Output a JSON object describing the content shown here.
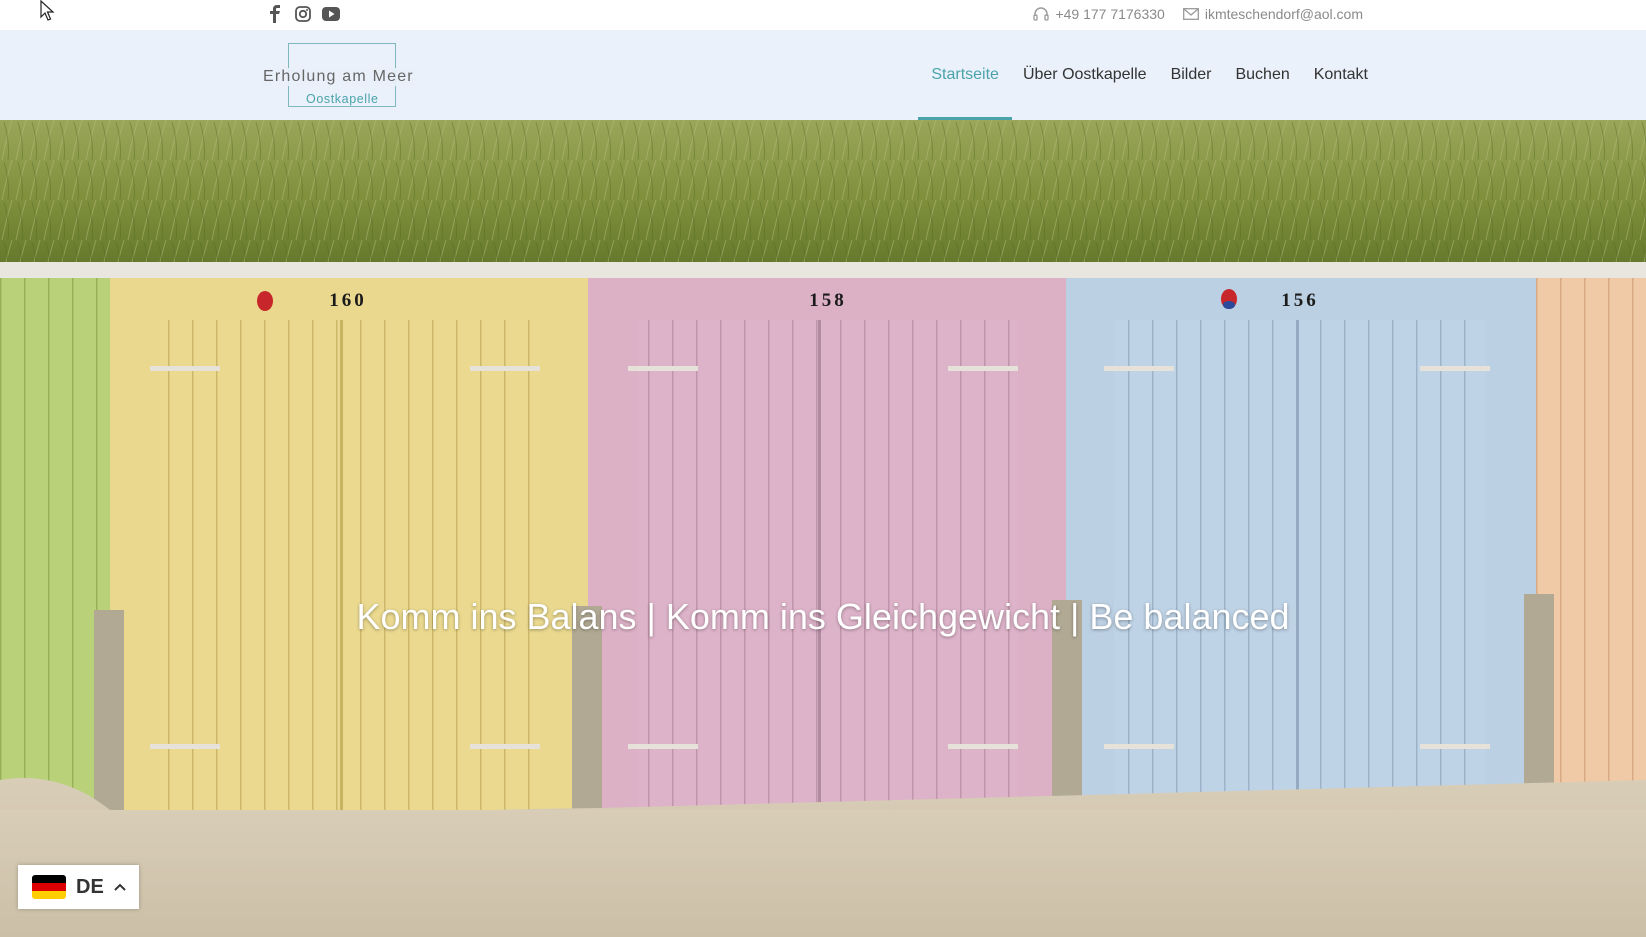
{
  "topbar": {
    "social": [
      {
        "icon": "facebook-icon"
      },
      {
        "icon": "instagram-icon"
      },
      {
        "icon": "youtube-icon"
      }
    ],
    "phone": "+49 177 7176330",
    "email": "ikmteschendorf@aol.com"
  },
  "logo": {
    "line1": "Erholung am Meer",
    "line2": "Oostkapelle"
  },
  "nav": {
    "items": [
      {
        "label": "Startseite",
        "active": true
      },
      {
        "label": "Über Oostkapelle"
      },
      {
        "label": "Bilder"
      },
      {
        "label": "Buchen"
      },
      {
        "label": "Kontakt"
      }
    ]
  },
  "hero": {
    "tagline": "Komm ins Balans | Komm ins Gleichgewicht | Be balanced",
    "cabins": [
      "160",
      "158",
      "156"
    ]
  },
  "language": {
    "code": "DE",
    "flag_colors": [
      "#000000",
      "#dd0000",
      "#ffce00"
    ]
  },
  "colors": {
    "accent": "#4aa3ab"
  }
}
